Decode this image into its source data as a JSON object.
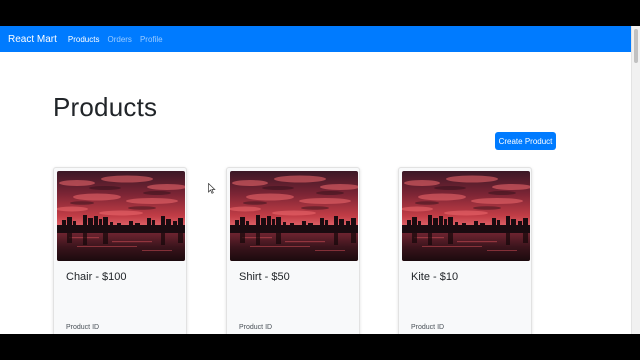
{
  "navbar": {
    "brand": "React Mart",
    "links": [
      {
        "label": "Products",
        "active": true
      },
      {
        "label": "Orders",
        "active": false
      },
      {
        "label": "Profile",
        "active": false
      }
    ]
  },
  "page": {
    "title": "Products",
    "create_button_label": "Create Product"
  },
  "products": [
    {
      "title": "Chair - $100",
      "meta_label": "Product ID"
    },
    {
      "title": "Shirt - $50",
      "meta_label": "Product ID"
    },
    {
      "title": "Kite - $10",
      "meta_label": "Product ID"
    }
  ],
  "colors": {
    "primary": "#007bff",
    "card_bg": "#f8f9fa",
    "text": "#212529"
  }
}
